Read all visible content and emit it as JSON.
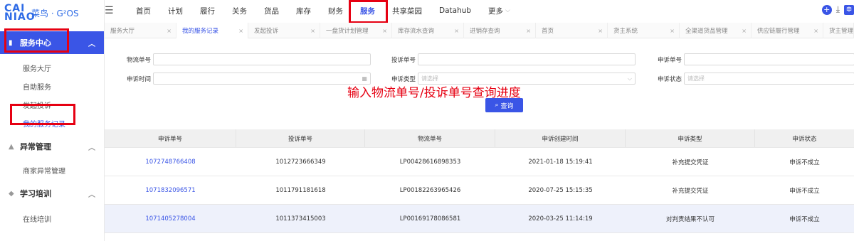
{
  "logo": {
    "cai": "CAI NIAO",
    "rest": "菜鸟 · G²OS"
  },
  "topnav": {
    "items": [
      "首页",
      "计划",
      "履行",
      "关务",
      "货品",
      "库存",
      "财务",
      "服务",
      "共享菜园",
      "Datahub",
      "更多"
    ],
    "more_chevron": "⌵",
    "avatar": "申"
  },
  "sidebar": {
    "groups": [
      {
        "label": "服务中心",
        "items": [
          "服务大厅",
          "自助服务",
          "发起投诉",
          "我的服务记录"
        ]
      },
      {
        "label": "异常管理",
        "items": [
          "商家异常管理"
        ]
      },
      {
        "label": "学习培训",
        "items": [
          "在线培训"
        ]
      }
    ]
  },
  "tabs": [
    "服务大厅",
    "我的服务记录",
    "发起投诉",
    "一盘货计划管理",
    "库存流水查询",
    "进销存查询",
    "首页",
    "货主系统",
    "全渠道货品管理",
    "供应链履行管理",
    "货主管理"
  ],
  "filters": {
    "logistics_no": "物流单号",
    "complaint_no": "投诉单号",
    "appeal_no": "申诉单号",
    "appeal_time": "申诉时间",
    "appeal_type": "申诉类型",
    "appeal_status": "申诉状态",
    "placeholder": "请选择"
  },
  "annotation": "输入物流单号/投诉单号查询进度",
  "query_button": "查询",
  "table": {
    "headers": [
      "申诉单号",
      "投诉单号",
      "物流单号",
      "申诉创建时间",
      "申诉类型",
      "申诉状态"
    ],
    "rows": [
      [
        "1072748766408",
        "1012723666349",
        "LP00428616898353",
        "2021-01-18 15:19:41",
        "补充提交凭证",
        "申诉不成立"
      ],
      [
        "1071832096571",
        "1011791181618",
        "LP00182263965426",
        "2020-07-25 15:15:35",
        "补充提交凭证",
        "申诉不成立"
      ],
      [
        "1071405278004",
        "1011373415003",
        "LP00169178086581",
        "2020-03-25 11:14:19",
        "对判责结果不认可",
        "申诉不成立"
      ]
    ]
  },
  "colors": {
    "accent": "#3a55e6",
    "highlight": "#e60012"
  }
}
